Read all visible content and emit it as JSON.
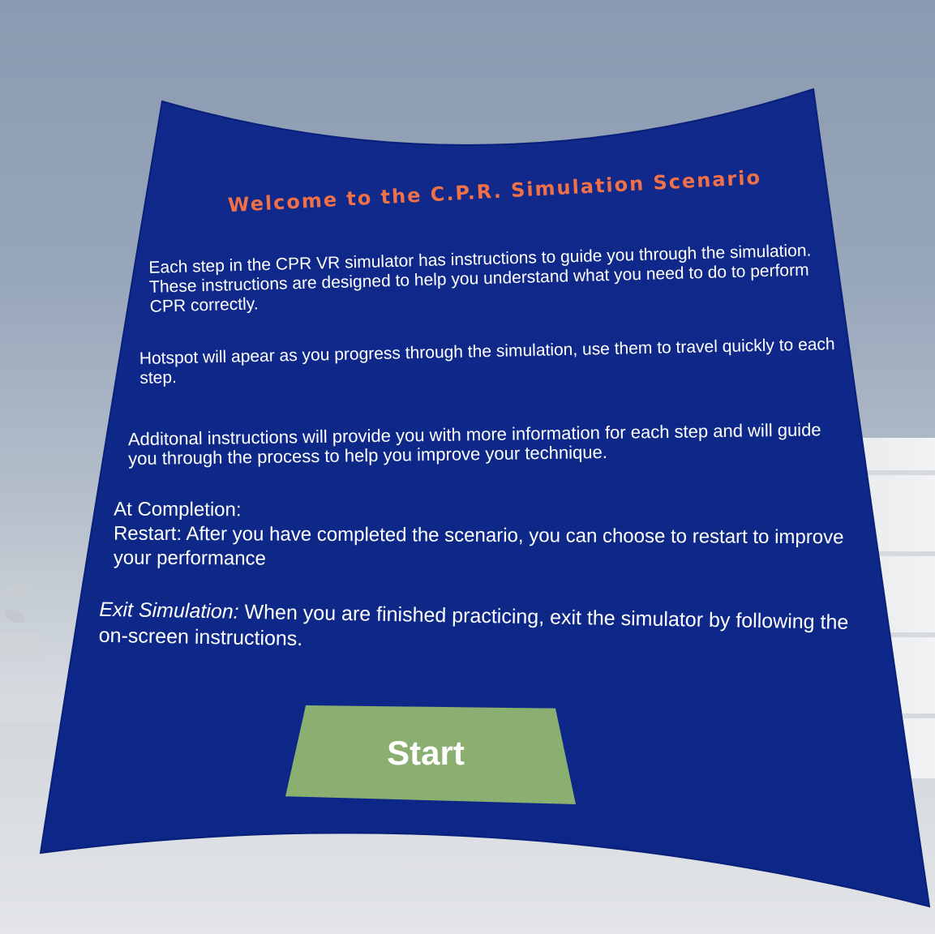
{
  "panel": {
    "title": "Welcome to the C.P.R. Simulation Scenario",
    "paragraphs": {
      "steps": "Each step in the CPR VR simulator has instructions to guide you through the simulation. These instructions are designed to help you understand what you need to do to perform CPR correctly.",
      "hotspot": "Hotspot will apear as you progress through the simulation, use them to travel quickly to each step.",
      "additional": "Additonal instructions will provide you with more information for each step and will guide you through the process to help you improve your technique.",
      "completion_heading": "At Completion:",
      "restart": "Restart: After you have completed the scenario, you can choose to restart to improve your performance",
      "exit_lead": "Exit Simulation:",
      "exit_text": "When you are finished practicing, exit the simulator by following the on-screen instructions."
    },
    "start_label": "Start"
  },
  "colors": {
    "panel": "#0e2a88",
    "title": "#f07048",
    "button": "#8aaf70",
    "text": "#ffffff"
  }
}
